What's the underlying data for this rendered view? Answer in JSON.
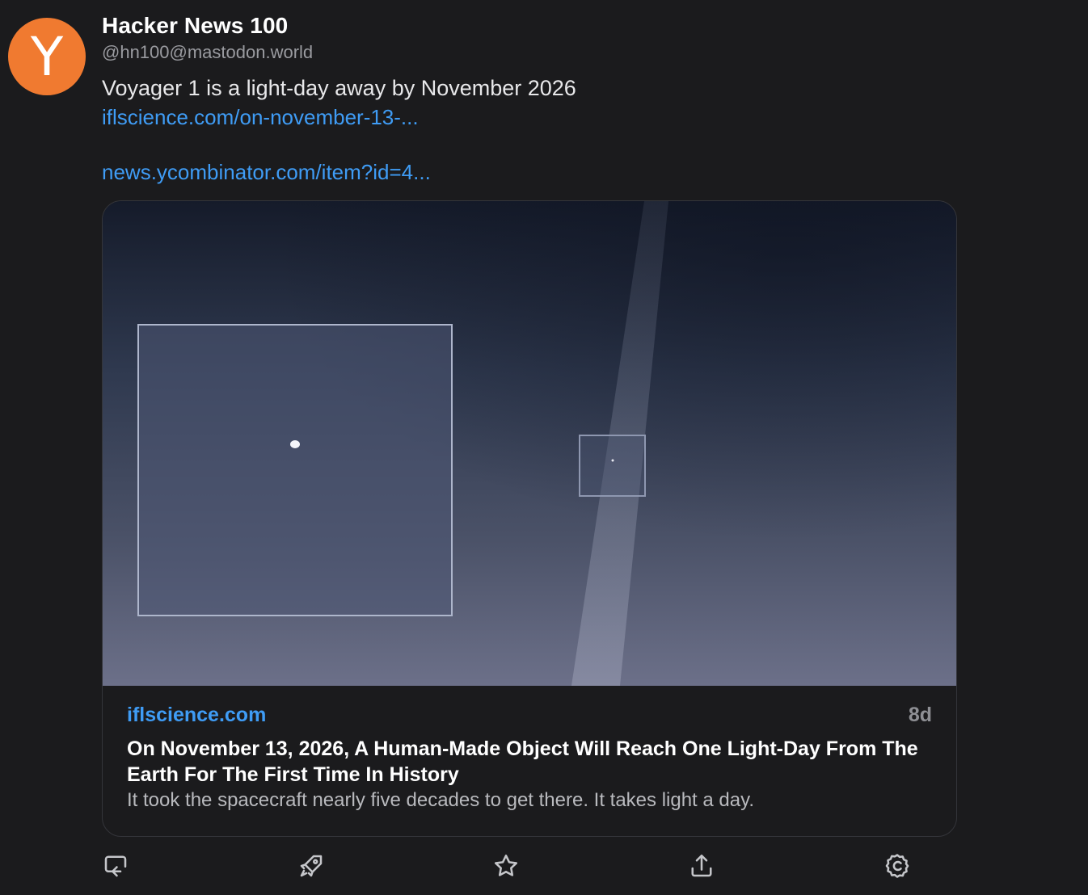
{
  "post": {
    "avatar_letter": "Y",
    "display_name": "Hacker News 100",
    "handle": "@hn100@mastodon.world",
    "text": "Voyager 1 is a light-day away by November 2026",
    "links": [
      "iflscience.com/on-november-13-...",
      "news.ycombinator.com/item?id=4..."
    ]
  },
  "card": {
    "source": "iflscience.com",
    "age": "8d",
    "title": "On November 13, 2026, A Human-Made Object Will Reach One Light-Day From The Earth For The First Time In History",
    "description": "It took the spacecraft nearly five decades to get there. It takes light a day."
  },
  "actions": {
    "icons": [
      "reply-icon",
      "boost-icon",
      "favorite-icon",
      "share-icon",
      "more-icon"
    ]
  },
  "colors": {
    "background": "#1b1b1d",
    "avatar": "#f07a30",
    "link": "#3f9cf5",
    "muted": "#8e8f94"
  }
}
